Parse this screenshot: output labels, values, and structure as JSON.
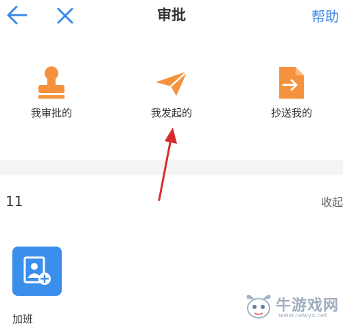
{
  "header": {
    "title": "审批",
    "help_label": "帮助"
  },
  "actions": [
    {
      "label": "我审批的",
      "icon": "stamp-icon"
    },
    {
      "label": "我发起的",
      "icon": "paper-plane-icon"
    },
    {
      "label": "抄送我的",
      "icon": "forward-document-icon"
    }
  ],
  "section": {
    "count": "11",
    "collapse_label": "收起"
  },
  "apps": [
    {
      "label": "加班",
      "icon": "overtime-add-icon"
    }
  ],
  "watermark": {
    "text": "牛游戏网",
    "url": "www.newyx.net"
  },
  "colors": {
    "orange": "#f5923e",
    "blue": "#3b87e6",
    "tile_blue": "#3b8fec",
    "arrow_red": "#d92b2b"
  }
}
